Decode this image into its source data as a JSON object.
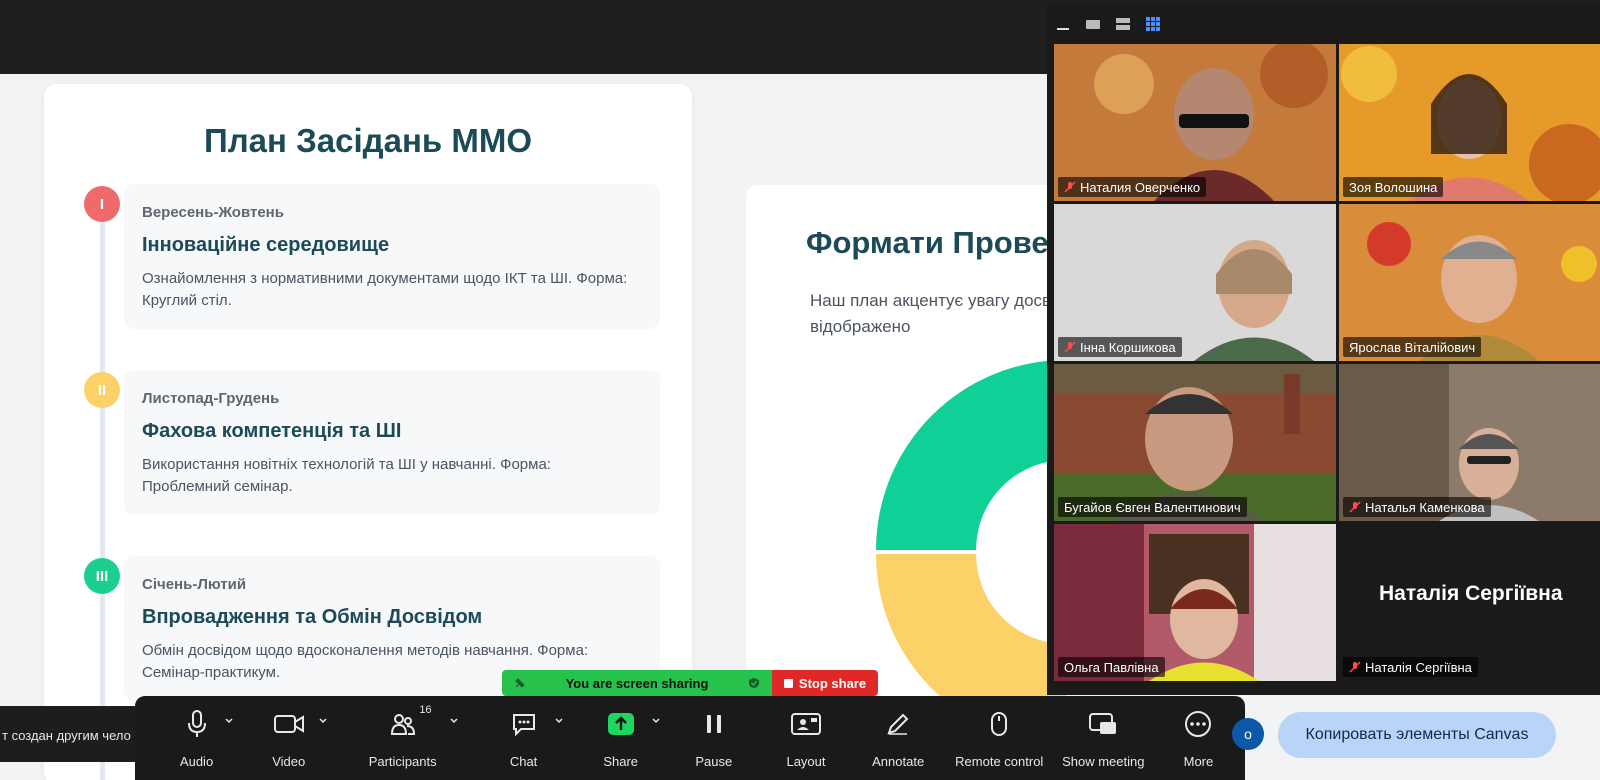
{
  "slide": {
    "title": "План Засідань ММО",
    "steps": [
      {
        "num": "I",
        "color": "#ef6b6b",
        "period": "Вересень-Жовтень",
        "heading": "Інноваційне середовище",
        "desc": "Ознайомлення з нормативними документами щодо ІКТ та ШІ. Форма: Круглий стіл."
      },
      {
        "num": "II",
        "color": "#fbd168",
        "period": "Листопад-Грудень",
        "heading": "Фахова компетенція та ШІ",
        "desc": "Використання новітніх технологій та ШІ у навчанні. Форма: Проблемний семінар."
      },
      {
        "num": "III",
        "color": "#1ccf8f",
        "period": "Січень-Лютий",
        "heading": "Впровадження та Обмін Досвідом",
        "desc": "Обмін досвідом щодо вдосконалення методів навчання. Форма: Семінар-практикум."
      }
    ]
  },
  "formats": {
    "title": "Формати Прове",
    "text": "Наш план акцентує увагу досвідом, що відображено",
    "donut_colors": [
      "#0fd097",
      "#fbd168"
    ]
  },
  "participants": [
    {
      "name": "Наталия Оверченко",
      "muted": true,
      "bg": "#c47a3b"
    },
    {
      "name": "Зоя Волошина",
      "muted": false,
      "bg": "#e59a2a"
    },
    {
      "name": "Інна Коршикова",
      "muted": true,
      "bg": "#d9d9d9"
    },
    {
      "name": "Ярослав Віталійович",
      "muted": false,
      "bg": "#d98c3a"
    },
    {
      "name": "Бугайов Євген Валентинович",
      "muted": false,
      "bg": "#6d5a42",
      "active": true
    },
    {
      "name": "Наталья Каменкова",
      "muted": true,
      "bg": "#8c7a6a"
    },
    {
      "name": "Ольга Павлівна",
      "muted": false,
      "bg": "#b25a6a"
    },
    {
      "name": "Наталія Сергіївна",
      "muted": true,
      "bg": "#1a1a1a",
      "big_name": "Наталія Сергіївна"
    }
  ],
  "sharing": {
    "status": "You are screen sharing",
    "stop": "Stop share"
  },
  "notice": "т создан другим чело",
  "toolbar": {
    "audio": "Audio",
    "video": "Video",
    "participants": "Participants",
    "participants_count": "16",
    "chat": "Chat",
    "share": "Share",
    "pause": "Pause",
    "layout": "Layout",
    "annotate": "Annotate",
    "remote": "Remote control",
    "show_meeting": "Show meeting",
    "more": "More"
  },
  "circle_btn": "о",
  "canvas_btn": "Копировать элементы Canvas"
}
